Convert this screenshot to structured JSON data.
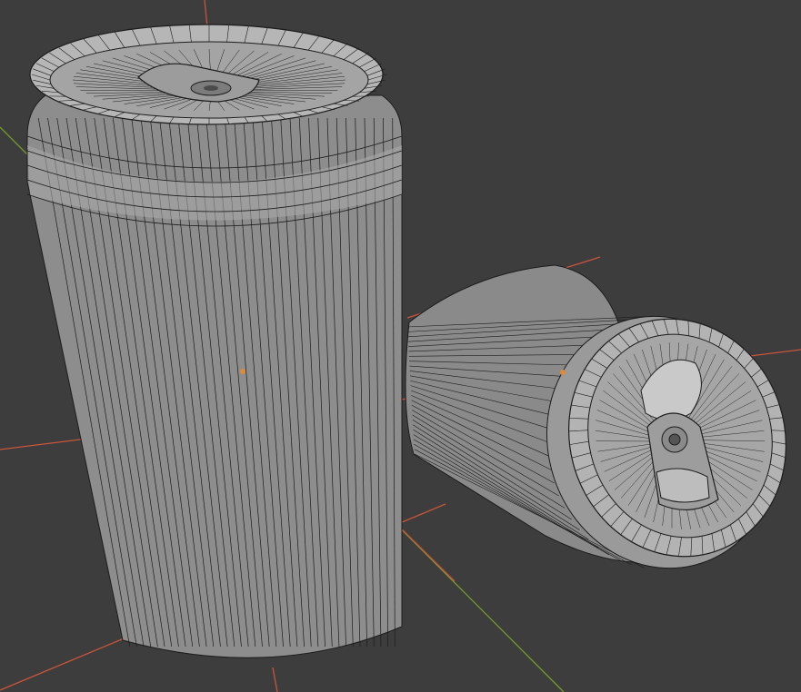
{
  "app": {
    "window": "3d-viewport",
    "shading_mode": "solid-wireframe-overlay"
  },
  "colors": {
    "background": "#3d3d3d",
    "mesh_fill": "#8f8f8f",
    "mesh_light": "#b8b8b8",
    "wire": "#1c1c1c",
    "axis_x": "#c8553a",
    "axis_y": "#7a9a2a",
    "origin_dot": "#e0893a"
  },
  "scene": {
    "objects": [
      {
        "name": "standing-can",
        "orientation": "upright",
        "selected": false
      },
      {
        "name": "lying-can",
        "orientation": "tipped-over",
        "selected": false
      }
    ],
    "wire_segments": {
      "body_vertical": 40,
      "rim_radial": 56
    }
  }
}
